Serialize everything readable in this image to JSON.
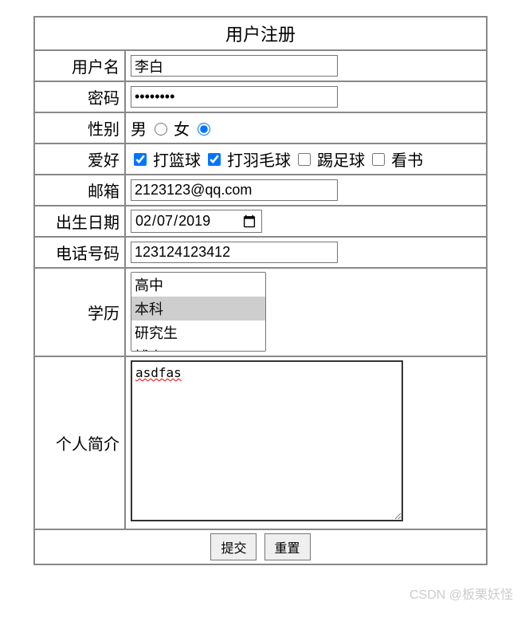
{
  "title": "用户注册",
  "labels": {
    "username": "用户名",
    "password": "密码",
    "gender": "性别",
    "hobby": "爱好",
    "email": "邮箱",
    "birthdate": "出生日期",
    "phone": "电话号码",
    "education": "学历",
    "bio": "个人简介"
  },
  "values": {
    "username": "李白",
    "password": "••••••••",
    "email": "2123123@qq.com",
    "birthdate": "2019-02-07",
    "phone": "123124123412",
    "bio": "asdfas"
  },
  "gender_options": {
    "male": "男",
    "female": "女"
  },
  "gender_selected": "female",
  "hobby_options": [
    {
      "key": "basketball",
      "label": "打篮球",
      "checked": true
    },
    {
      "key": "badminton",
      "label": "打羽毛球",
      "checked": true
    },
    {
      "key": "football",
      "label": "踢足球",
      "checked": false
    },
    {
      "key": "reading",
      "label": "看书",
      "checked": false
    }
  ],
  "education_options": [
    {
      "label": "高中",
      "selected": false
    },
    {
      "label": "本科",
      "selected": true
    },
    {
      "label": "研究生",
      "selected": false
    },
    {
      "label": "博士",
      "selected": false
    }
  ],
  "buttons": {
    "submit": "提交",
    "reset": "重置"
  },
  "watermark": "CSDN @板栗妖怪"
}
